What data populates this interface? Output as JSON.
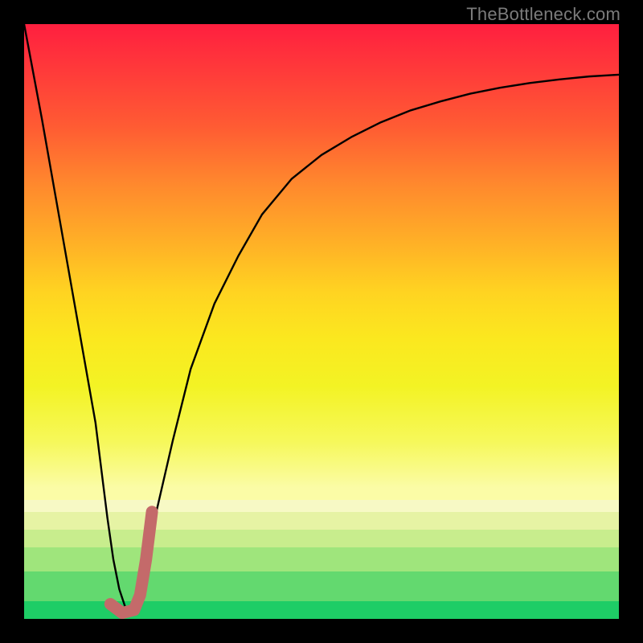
{
  "watermark": {
    "text": "TheBottleneck.com"
  },
  "chart_data": {
    "type": "line",
    "title": "",
    "xlabel": "",
    "ylabel": "",
    "xlim": [
      0,
      100
    ],
    "ylim": [
      0,
      100
    ],
    "grid": false,
    "background": {
      "kind": "vertical-gradient",
      "stops": [
        {
          "y_pct": 100,
          "color": "#ff1f3f"
        },
        {
          "y_pct": 78,
          "color": "#ff5b33"
        },
        {
          "y_pct": 55,
          "color": "#ffb326"
        },
        {
          "y_pct": 35,
          "color": "#fbe81f"
        },
        {
          "y_pct": 22,
          "color": "#fbfca6"
        },
        {
          "y_pct": 20,
          "color": "#f7f9c5"
        },
        {
          "y_pct": 18,
          "color": "#e6f3a4"
        },
        {
          "y_pct": 15,
          "color": "#c8ed8d"
        },
        {
          "y_pct": 12,
          "color": "#9fe57c"
        },
        {
          "y_pct": 8,
          "color": "#63d96f"
        },
        {
          "y_pct": 3,
          "color": "#1ecd66"
        },
        {
          "y_pct": 0,
          "color": "#04c763"
        }
      ]
    },
    "series": [
      {
        "name": "bottleneck-curve",
        "stroke": "#000000",
        "stroke_width": 2.4,
        "x": [
          0,
          3,
          6,
          9,
          12,
          14,
          15,
          16,
          17,
          18,
          19,
          20,
          22,
          25,
          28,
          32,
          36,
          40,
          45,
          50,
          55,
          60,
          65,
          70,
          75,
          80,
          85,
          90,
          95,
          100
        ],
        "y": [
          100,
          84,
          67,
          50,
          33,
          17,
          10,
          5,
          2,
          1,
          3,
          8,
          17,
          30,
          42,
          53,
          61,
          68,
          74,
          78,
          81,
          83.5,
          85.5,
          87,
          88.3,
          89.3,
          90.1,
          90.7,
          91.2,
          91.5
        ]
      },
      {
        "name": "highlight-j",
        "stroke": "#c46a6a",
        "stroke_width": 15,
        "linecap": "round",
        "x": [
          14.5,
          16.5,
          18.5,
          19.5,
          20.5,
          21.5
        ],
        "y": [
          2.5,
          1.0,
          1.5,
          4.0,
          10.0,
          18.0
        ]
      }
    ]
  },
  "palette": {
    "frame_bg": "#000000",
    "watermark": "#7b7b7b"
  }
}
